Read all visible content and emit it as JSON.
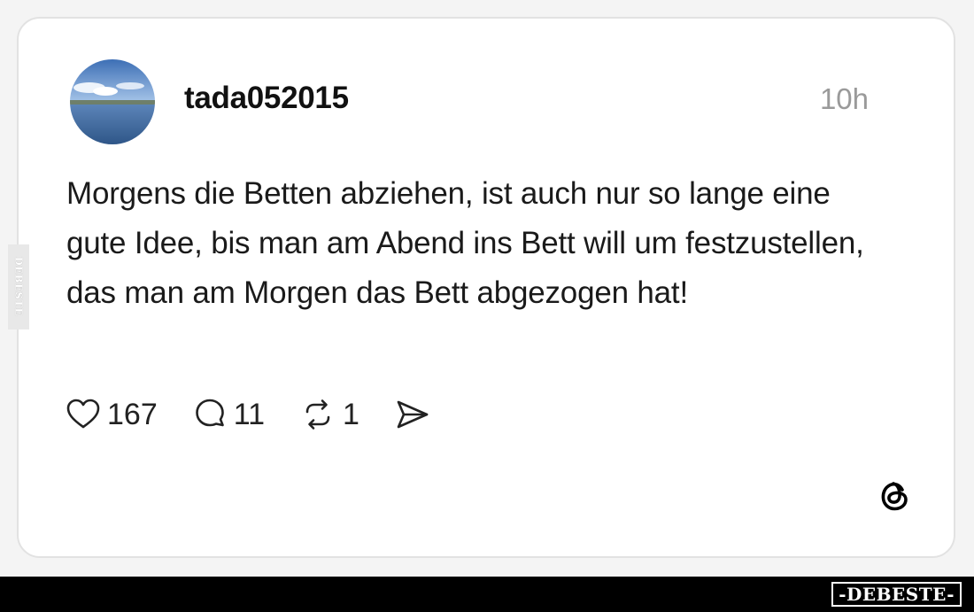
{
  "post": {
    "username": "tada052015",
    "timestamp": "10h",
    "text": "Morgens die Betten abziehen, ist auch nur so lange eine gute Idee, bis man am Abend ins Bett will um festzustellen, das man am Morgen das Bett abgezogen hat!",
    "avatar_icon": "landscape-avatar",
    "actions": {
      "likes": "167",
      "replies": "11",
      "reposts": "1",
      "like_icon": "heart-icon",
      "reply_icon": "comment-icon",
      "repost_icon": "repost-icon",
      "share_icon": "send-icon"
    },
    "platform_icon": "threads-logo-icon"
  },
  "watermark": {
    "side": "DEBESTE",
    "bottom": "-DEBESTE-"
  },
  "colors": {
    "card_background": "#ffffff",
    "card_border": "#e2e2e2",
    "text": "#1a1a1a",
    "timestamp": "#9a9a9a",
    "bottom_bar": "#000000"
  }
}
